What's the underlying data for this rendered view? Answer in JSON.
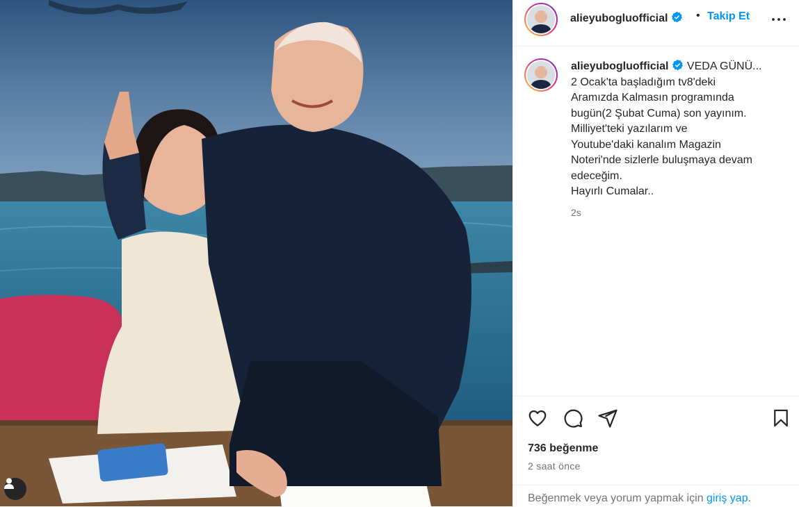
{
  "post": {
    "username": "alieyubogluofficial",
    "follow_label": "Takip Et",
    "separator": "•",
    "caption_lines": [
      "VEDA GÜNÜ...",
      "2 Ocak'ta başladığım tv8'deki",
      "Aramızda Kalmasın programında",
      "bugün(2 Şubat Cuma) son yayınım.",
      "Milliyet'teki yazılarım ve",
      "Youtube'daki kanalım Magazin",
      "Noteri'nde sizlerle buluşmaya devam",
      "edeceğim.",
      "Hayırlı Cumalar.."
    ],
    "caption_age": "2s",
    "likes": "736 beğenme",
    "posted_ago": "2 saat önce",
    "login_prompt": "Beğenmek veya yorum yapmak için",
    "login_link": "giriş yap",
    "login_end": "."
  },
  "icons": {
    "verified": "verified-badge-icon",
    "more": "more-options-icon",
    "like": "heart-icon",
    "comment": "comment-icon",
    "share": "share-icon",
    "save": "bookmark-icon",
    "user_tag": "user-tag-icon"
  },
  "colors": {
    "accent": "#0095f6",
    "verified": "#0095f6",
    "text": "#262626",
    "muted": "#737373",
    "border": "#efefef"
  }
}
